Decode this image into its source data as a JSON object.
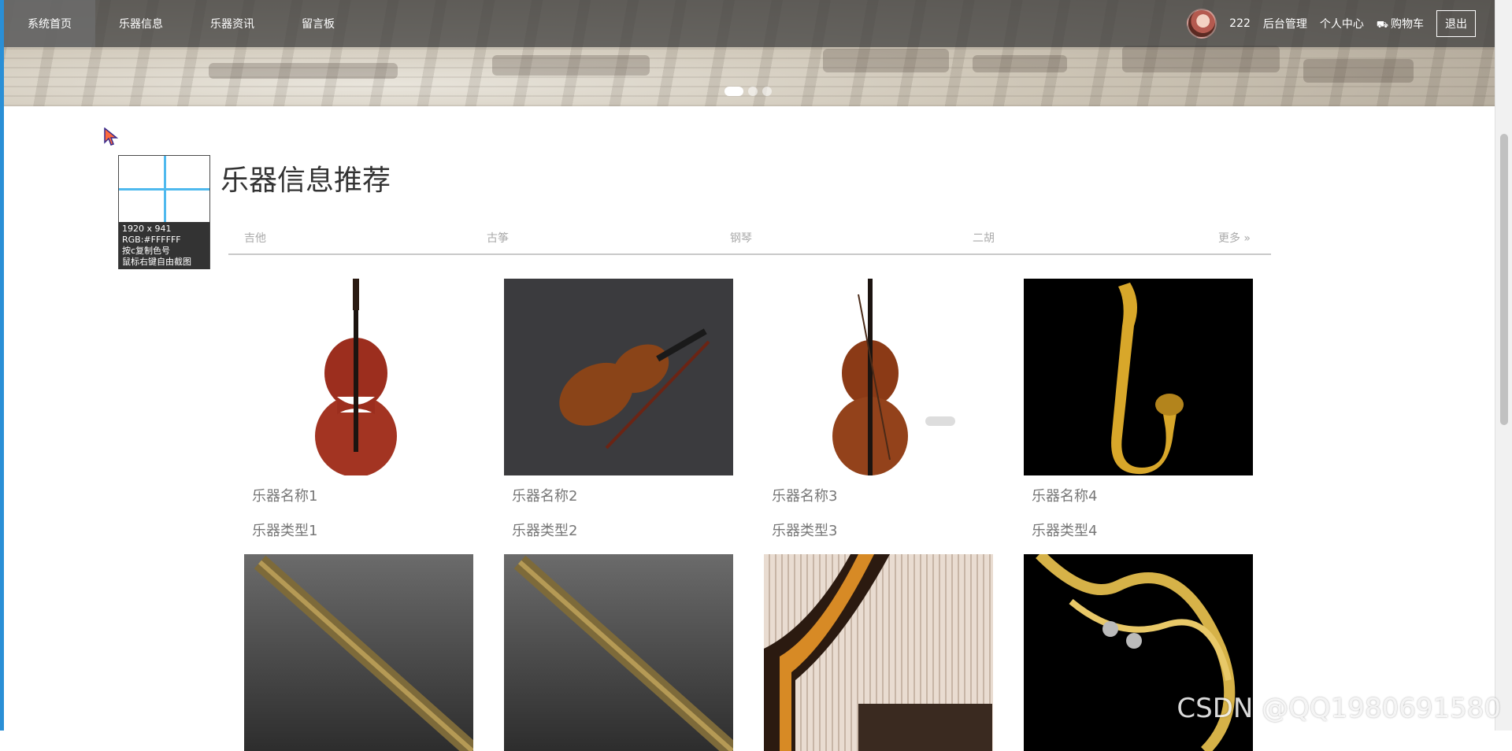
{
  "nav": {
    "items": [
      {
        "label": "系统首页",
        "active": true
      },
      {
        "label": "乐器信息",
        "active": false
      },
      {
        "label": "乐器资讯",
        "active": false
      },
      {
        "label": "留言板",
        "active": false
      }
    ],
    "username": "222",
    "admin_label": "后台管理",
    "profile_label": "个人中心",
    "cart_label": "购物车",
    "logout_label": "退出"
  },
  "snip_tool": {
    "size": "1920 x 941",
    "rgb": "RGB:#FFFFFF",
    "copy_hint": "按c复制色号",
    "capture_hint": "鼠标右键自由截图"
  },
  "section": {
    "title": "乐器信息推荐",
    "categories": [
      "吉他",
      "古筝",
      "钢琴",
      "二胡"
    ],
    "more_label": "更多 »"
  },
  "products": [
    {
      "name": "乐器名称1",
      "type": "乐器类型1"
    },
    {
      "name": "乐器名称2",
      "type": "乐器类型2"
    },
    {
      "name": "乐器名称3",
      "type": "乐器类型3"
    },
    {
      "name": "乐器名称4",
      "type": "乐器类型4"
    }
  ],
  "watermark": "CSDN @QQ1980691580"
}
